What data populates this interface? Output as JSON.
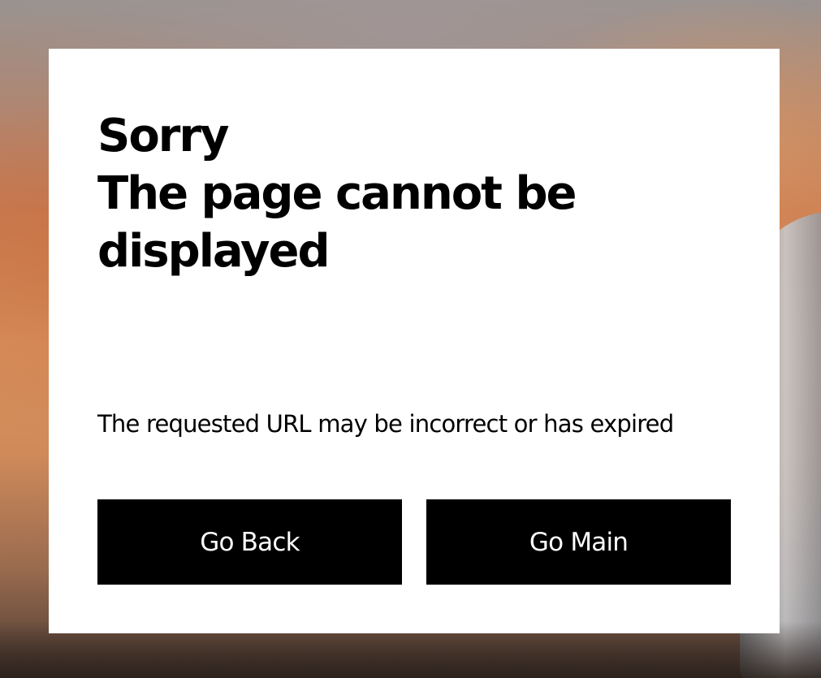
{
  "error": {
    "title_line1": "Sorry",
    "title_line2": "The page cannot be",
    "title_line3": "displayed",
    "message": "The requested URL may be incorrect or has expired"
  },
  "actions": {
    "back_label": "Go Back",
    "main_label": "Go Main"
  },
  "colors": {
    "button_bg": "#000000",
    "button_text": "#ffffff",
    "dialog_bg": "#ffffff"
  }
}
